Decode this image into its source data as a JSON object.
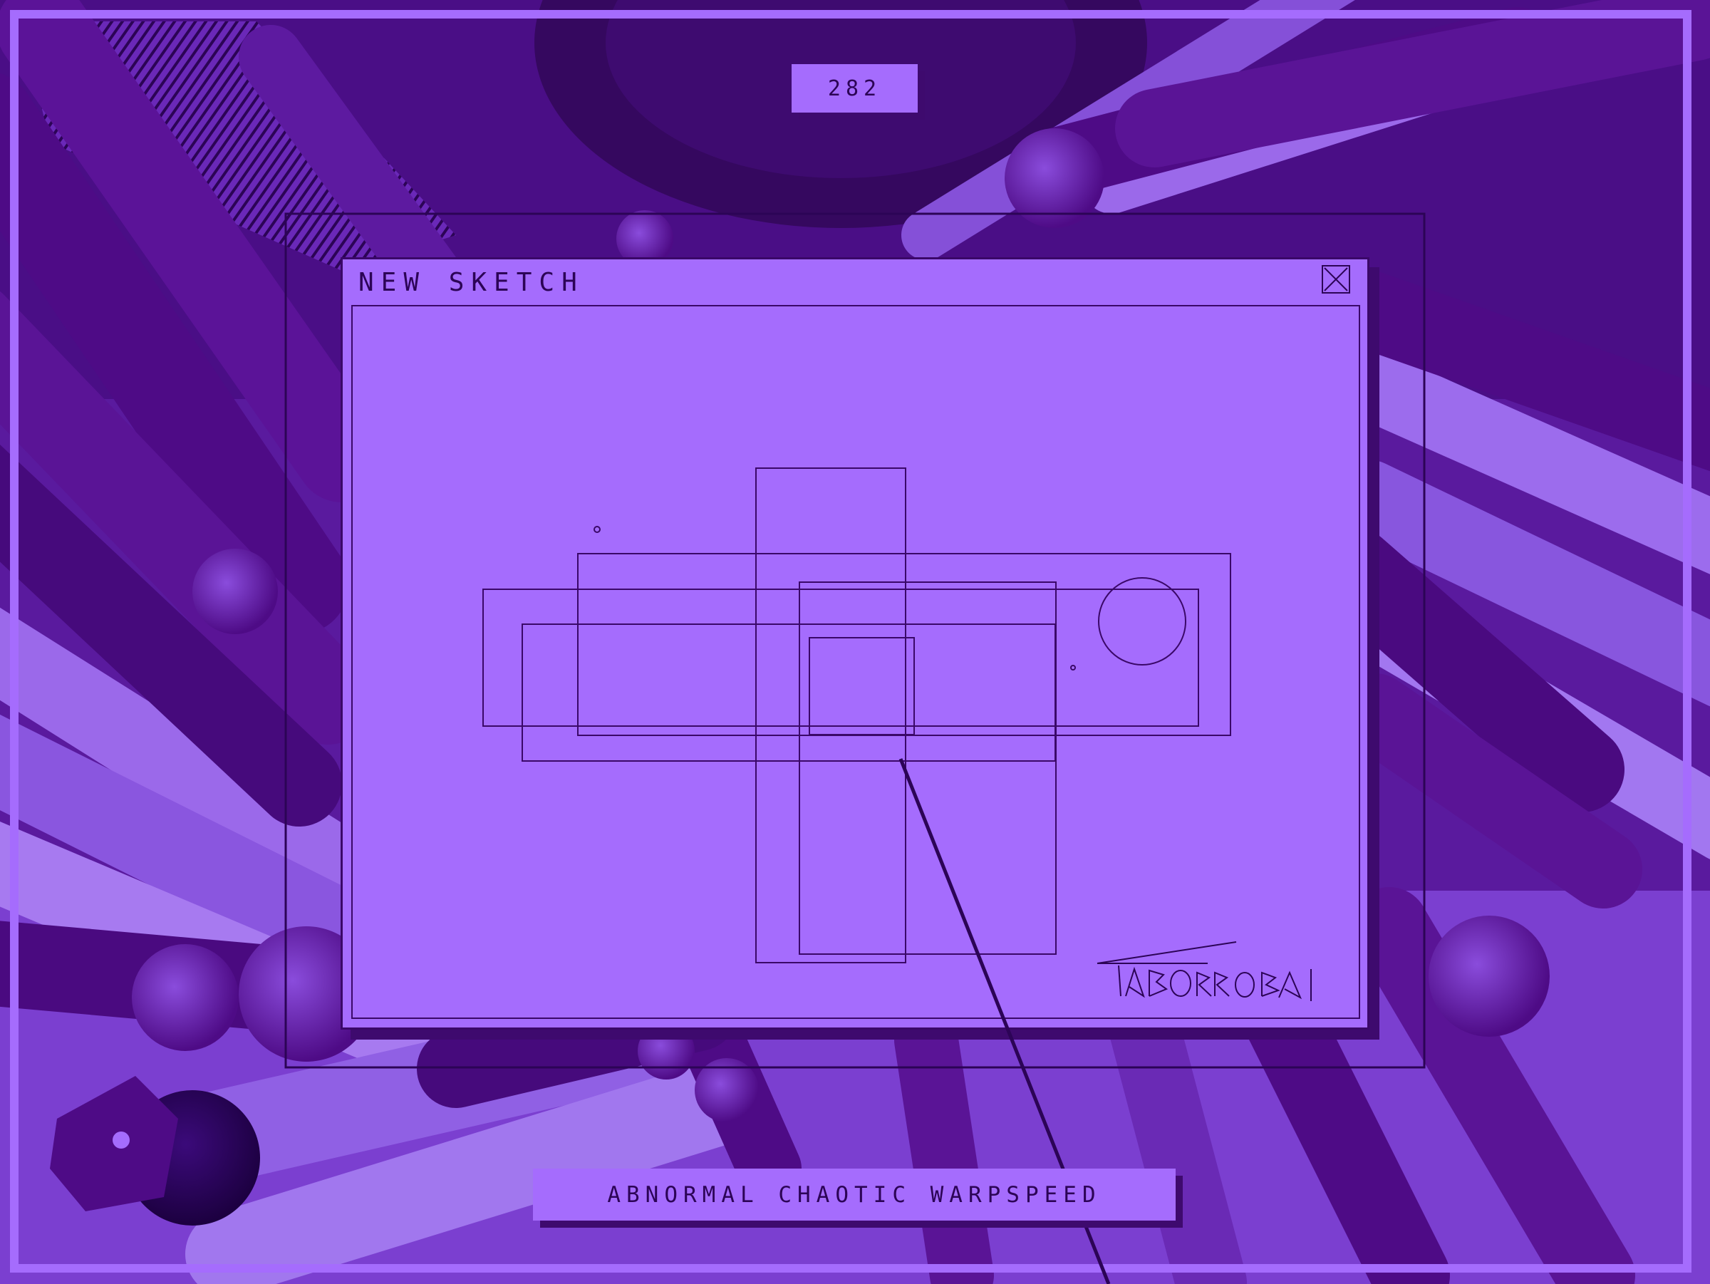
{
  "counter": {
    "value": "282"
  },
  "window": {
    "title": "NEW SKETCH",
    "close_icon": "close-icon"
  },
  "caption": {
    "text": "ABNORMAL CHAOTIC WARPSPEED"
  },
  "signature": {
    "text": "TABORROBAK"
  },
  "colors": {
    "accent": "#a56cfd",
    "dark": "#2c0456",
    "deep": "#3e0a6e",
    "tube_dark": "#4e0b86",
    "tube_light": "#9b69ea"
  }
}
